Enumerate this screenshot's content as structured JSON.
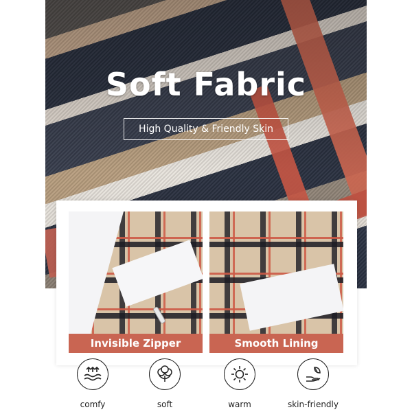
{
  "hero": {
    "title": "Soft Fabric",
    "subtitle": "High Quality & Friendly Skin"
  },
  "cards": [
    {
      "label": "Invisible Zipper"
    },
    {
      "label": "Smooth Lining"
    }
  ],
  "features": [
    {
      "label": "comfy",
      "icon": "waves-up-arrows-icon"
    },
    {
      "label": "soft",
      "icon": "cotton-flower-icon"
    },
    {
      "label": "warm",
      "icon": "sun-icon"
    },
    {
      "label": "skin-friendly",
      "icon": "hand-leaf-icon"
    }
  ],
  "colors": {
    "label_bar": "#c96552",
    "navy": "#2d3444",
    "coral": "#d56b55",
    "tan": "#c3a887"
  }
}
